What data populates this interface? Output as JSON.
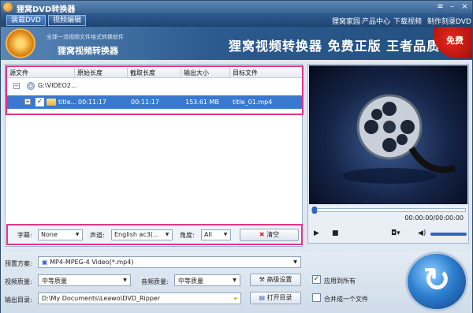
{
  "window": {
    "title": "狸窝DVD转换器"
  },
  "tabs": [
    "装载DVD",
    "视频编辑"
  ],
  "toplinks": [
    "狸窝家园",
    "产品中心",
    "下载视频",
    "制作刻录DVD"
  ],
  "banner": {
    "small_text": "全球一流视频文件格式转换软件",
    "name": "狸窝视频转换器",
    "slogan": "狸窝视频转换器  免费正版  王者品质",
    "badge": "免费"
  },
  "table": {
    "headers": [
      "源文件",
      "原始长度",
      "截取长度",
      "输出大小",
      "目标文件"
    ],
    "disc": "G:\\VIDEO2...",
    "row": {
      "name": "title...",
      "original": "00:11:17",
      "trim": "00:11:17",
      "size": "153.61 MB",
      "target": "title_01.mp4",
      "checked": true
    }
  },
  "subbar": {
    "subtitle_label": "字幕:",
    "subtitle_value": "None",
    "audio_label": "声道:",
    "audio_value": "English ac3(...",
    "angle_label": "角度:",
    "angle_value": "All",
    "clear_label": "清空"
  },
  "player": {
    "time": "00:00:00/00:00:00"
  },
  "bottom": {
    "preset_label": "预置方案:",
    "preset_value": "MP4-MPEG-4 Video(*.mp4)",
    "vq_label": "视频质量:",
    "vq_value": "中等质量",
    "aq_label": "音频质量:",
    "aq_value": "中等质量",
    "advanced_label": "高级设置",
    "apply_all_label": "应用到所有",
    "output_label": "输出目录:",
    "output_value": "D:\\My Documents\\Leawo\\DVD_Ripper",
    "open_dir_label": "打开目录",
    "merge_label": "合并成一个文件"
  },
  "colors": {
    "accent": "#3a78cf",
    "highlight_border": "#e0358a"
  }
}
